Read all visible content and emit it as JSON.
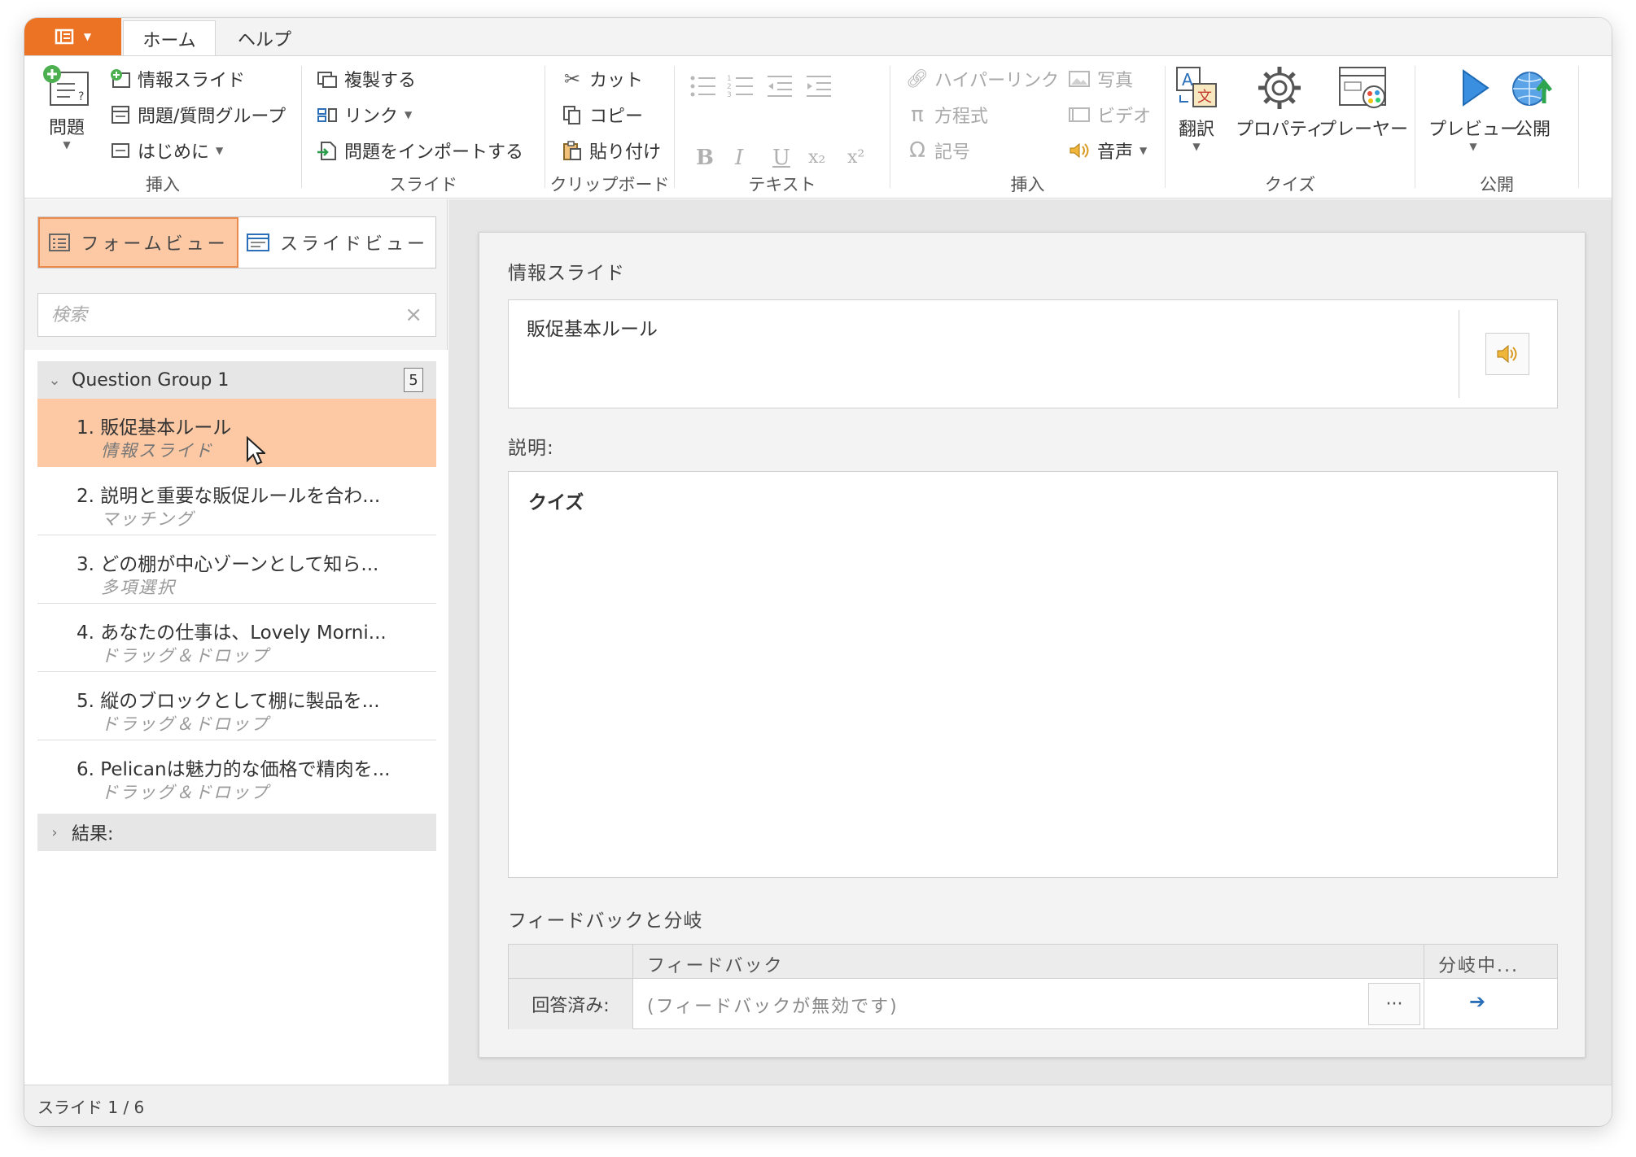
{
  "colors": {
    "accent": "#ec7224",
    "selection": "#fcc9a4",
    "link": "#2a6fb8"
  },
  "tabs": {
    "home": "ホーム",
    "help": "ヘルプ"
  },
  "ribbon": {
    "insert": {
      "label": "挿入",
      "question": "問題",
      "info_slide": "情報スライド",
      "question_group": "問題/質問グループ",
      "intro": "はじめに"
    },
    "slide": {
      "label": "スライド",
      "duplicate": "複製する",
      "link": "リンク",
      "import": "問題をインポートする"
    },
    "clipboard": {
      "label": "クリップボード",
      "cut": "カット",
      "copy": "コピー",
      "paste": "貼り付け"
    },
    "text": {
      "label": "テキスト",
      "bold": "B",
      "italic": "I",
      "underline": "U",
      "sub": "x₂",
      "sup": "x²"
    },
    "insert2": {
      "label": "挿入",
      "hyperlink": "ハイパーリンク",
      "equation": "方程式",
      "symbol": "記号",
      "photo": "写真",
      "video": "ビデオ",
      "audio": "音声"
    },
    "quiz": {
      "label": "クイズ",
      "translate": "翻訳",
      "properties": "プロパティ",
      "player": "プレーヤー"
    },
    "publish": {
      "label": "公開",
      "preview": "プレビュー",
      "publish": "公開"
    }
  },
  "left": {
    "form_view": "フォームビュー",
    "slide_view": "スライドビュー",
    "search_placeholder": "検索",
    "group": {
      "name": "Question Group 1",
      "count": "5"
    },
    "slides": [
      {
        "num": "1.",
        "title": "販促基本ルール",
        "type": "情報スライド"
      },
      {
        "num": "2.",
        "title": "説明と重要な販促ルールを合わ...",
        "type": "マッチング"
      },
      {
        "num": "3.",
        "title": "どの棚が中心ゾーンとして知ら...",
        "type": "多項選択"
      },
      {
        "num": "4.",
        "title": "あなたの仕事は、Lovely Morni...",
        "type": "ドラッグ＆ドロップ"
      },
      {
        "num": "5.",
        "title": "縦のブロックとして棚に製品を...",
        "type": "ドラッグ＆ドロップ"
      },
      {
        "num": "6.",
        "title": "Pelicanは魅力的な価格で精肉を...",
        "type": "ドラッグ＆ドロップ"
      }
    ],
    "results": "結果:"
  },
  "editor": {
    "section_title": "情報スライド",
    "title_value": "販促基本ルール",
    "desc_label": "説明:",
    "desc_value": "クイズ",
    "feedback_label": "フィードバックと分岐",
    "fb_col_feedback": "フィードバック",
    "fb_col_branch": "分岐中...",
    "fb_row_label": "回答済み:",
    "fb_value": "(フィードバックが無効です)",
    "fb_more": "···"
  },
  "status": "スライド 1 / 6"
}
